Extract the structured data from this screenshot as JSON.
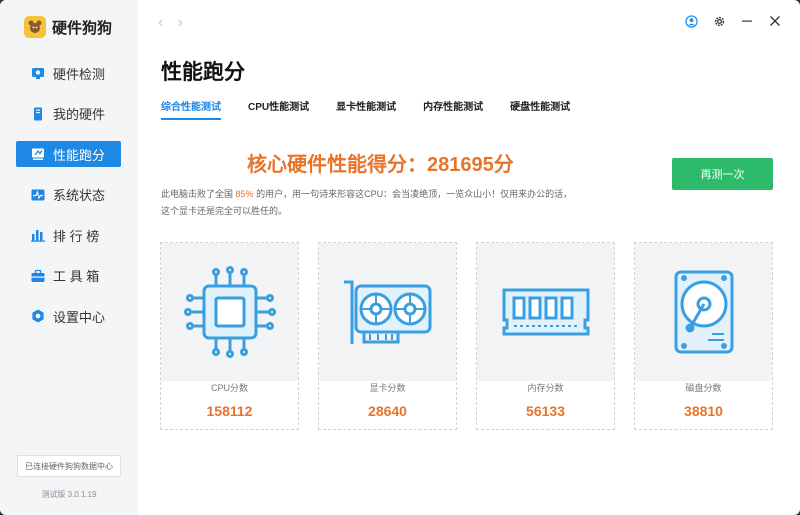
{
  "app": {
    "name": "硬件狗狗"
  },
  "sidebar": {
    "items": [
      {
        "label": "硬件检测",
        "icon": "hardware-scan-icon",
        "active": false
      },
      {
        "label": "我的硬件",
        "icon": "my-hardware-icon",
        "active": false
      },
      {
        "label": "性能跑分",
        "icon": "benchmark-icon",
        "active": true
      },
      {
        "label": "系统状态",
        "icon": "system-status-icon",
        "active": false
      },
      {
        "label": "排 行 榜",
        "icon": "ranking-icon",
        "active": false
      },
      {
        "label": "工 具 箱",
        "icon": "toolbox-icon",
        "active": false
      },
      {
        "label": "设置中心",
        "icon": "settings-center-icon",
        "active": false
      }
    ],
    "connect_label": "已连接硬件狗狗数据中心",
    "version": "测试版 3.0.1.19"
  },
  "page": {
    "title": "性能跑分"
  },
  "tabs": [
    {
      "label": "综合性能测试",
      "active": true
    },
    {
      "label": "CPU性能测试",
      "active": false
    },
    {
      "label": "显卡性能测试",
      "active": false
    },
    {
      "label": "内存性能测试",
      "active": false
    },
    {
      "label": "硬盘性能测试",
      "active": false
    }
  ],
  "score": {
    "label": "核心硬件性能得分：281695分",
    "desc_prefix": "此电脑击败了全国",
    "percent": "85%",
    "desc_suffix": "的用户，用一句诗来形容这CPU：会当凌绝顶，一览众山小！仅用来办公的话，",
    "desc_line2": "这个显卡还是完全可以胜任的。"
  },
  "retest_label": "再测一次",
  "cards": [
    {
      "label": "CPU分数",
      "value": "158112",
      "icon": "cpu-icon"
    },
    {
      "label": "显卡分数",
      "value": "28640",
      "icon": "gpu-icon"
    },
    {
      "label": "内存分数",
      "value": "56133",
      "icon": "memory-icon"
    },
    {
      "label": "磁盘分数",
      "value": "38810",
      "icon": "disk-icon"
    }
  ],
  "colors": {
    "accent": "#1e88e5",
    "score": "#e8732a",
    "retest": "#2dbb6b",
    "illustration": "#3a9fe0"
  }
}
